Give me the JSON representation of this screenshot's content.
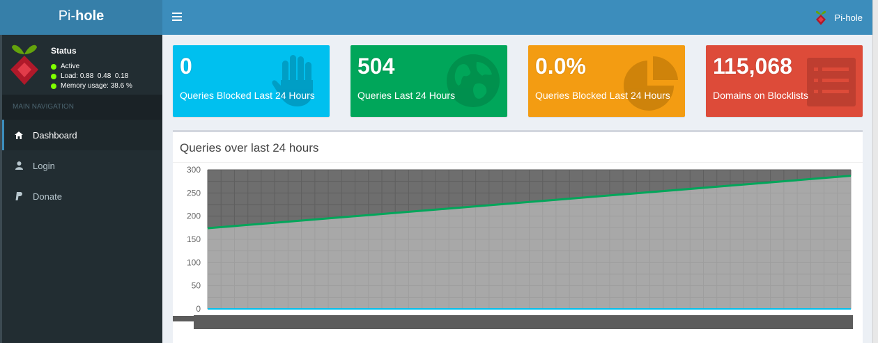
{
  "brand": {
    "prefix": "Pi-",
    "bold": "hole"
  },
  "topbar": {
    "user_label": "Pi-hole"
  },
  "status": {
    "title": "Status",
    "active": "Active",
    "load_label": "Load:",
    "load_values": "0.88  0.48  0.18",
    "memory_label": "Memory usage:",
    "memory_value": "38.6 %",
    "indicator_color": "#7fff00"
  },
  "sidebar": {
    "header": "MAIN NAVIGATION",
    "items": [
      {
        "label": "Dashboard",
        "icon": "home-icon",
        "active": true
      },
      {
        "label": "Login",
        "icon": "user-icon",
        "active": false
      },
      {
        "label": "Donate",
        "icon": "paypal-icon",
        "active": false
      }
    ]
  },
  "stats": [
    {
      "value": "0",
      "label": "Queries Blocked Last 24 Hours",
      "color": "#00c0ef",
      "icon": "hand-icon"
    },
    {
      "value": "504",
      "label": "Queries Last 24 Hours",
      "color": "#00a65a",
      "icon": "globe-icon"
    },
    {
      "value": "0.0%",
      "label": "Queries Blocked Last 24 Hours",
      "color": "#f39c12",
      "icon": "pie-chart-icon"
    },
    {
      "value": "115,068",
      "label": "Domains on Blocklists",
      "color": "#dd4b39",
      "icon": "list-icon"
    }
  ],
  "chart_box": {
    "title": "Queries over last 24 hours"
  },
  "chart_data": {
    "type": "line",
    "y_ticks": [
      "0",
      "50",
      "100",
      "150",
      "200",
      "250",
      "300"
    ],
    "ylim": [
      0,
      300
    ],
    "x_ticks_count": 144,
    "grid": true,
    "series": [
      {
        "values": [
          174,
          287
        ],
        "color": "#00a65a",
        "fill": "#a8a8a8"
      },
      {
        "values": [
          0,
          0
        ],
        "color": "#00c0ef"
      }
    ]
  }
}
